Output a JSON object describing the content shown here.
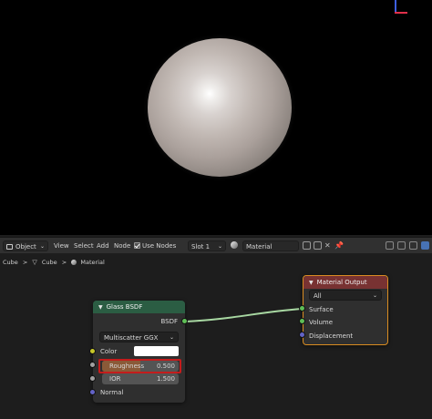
{
  "header": {
    "editor_type": "Object",
    "menus": [
      "View",
      "Select",
      "Add",
      "Node"
    ],
    "use_nodes_label": "Use Nodes",
    "slot": "Slot 1",
    "material_name": "Material"
  },
  "breadcrumb": {
    "items": [
      "Cube",
      "Cube",
      "Material"
    ],
    "separator": ">"
  },
  "glass_node": {
    "title": "Glass BSDF",
    "output_label": "BSDF",
    "distribution": "Multiscatter GGX",
    "color_label": "Color",
    "color_value": "#ffffff",
    "roughness_label": "Roughness",
    "roughness_value": "0.500",
    "ior_label": "IOR",
    "ior_value": "1.500",
    "normal_label": "Normal",
    "header_color": "#2b5d43"
  },
  "output_node": {
    "title": "Material Output",
    "target": "All",
    "inputs": [
      "Surface",
      "Volume",
      "Displacement"
    ],
    "header_color": "#783232"
  },
  "colors": {
    "shader_socket": "#5fbf57",
    "color_socket": "#c7c729",
    "float_socket": "#a1a1a1",
    "vector_socket": "#6363c7",
    "highlight": "#c41c1c",
    "link": "#a8d8a2"
  }
}
